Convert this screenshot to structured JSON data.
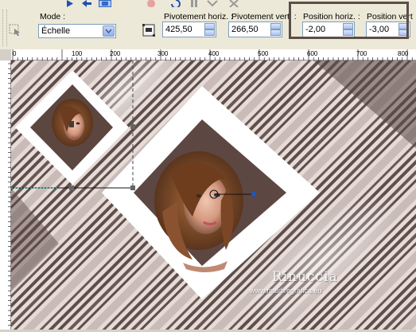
{
  "toolbar": {
    "mode_label": "Mode :",
    "mode_value": "Échelle",
    "rot_h_label": "Pivotement horiz. :",
    "rot_h_value": "425,50",
    "rot_v_label": "Pivotement vert. :",
    "rot_v_value": "266,50",
    "pos_h_label": "Position horiz. :",
    "pos_h_value": "-2,00",
    "pos_v_label": "Position vert",
    "pos_v_value": "-3,00"
  },
  "ruler": {
    "top_ticks": [
      "0",
      "100",
      "200",
      "300",
      "400",
      "500",
      "600",
      "700",
      "800"
    ]
  },
  "watermark": {
    "name": "Rinuccia",
    "url": "www.maidiregrafica.eu"
  },
  "colors": {
    "toolbar_bg": "#ece9d8",
    "highlight_border": "#5b4e48",
    "stripe_dark": "#6b5a55",
    "stripe_light": "#e8dcd8"
  },
  "icons": [
    "pick-tool-icon",
    "apply-icon",
    "undo-icon",
    "pause-icon",
    "redo-icon",
    "cancel-icon",
    "snap-icon",
    "rotation-pivot-icon"
  ]
}
